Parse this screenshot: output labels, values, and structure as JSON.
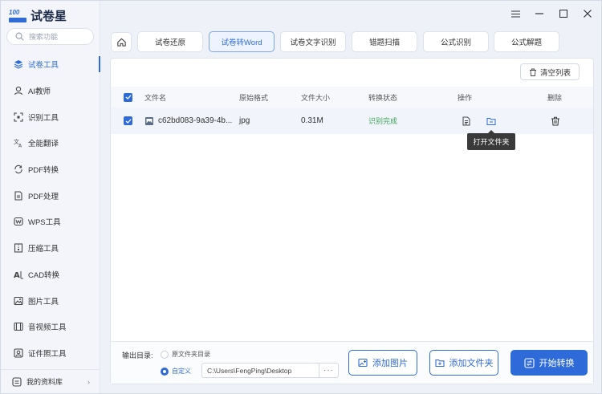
{
  "app": {
    "logo_badge": "100",
    "title": "试卷星"
  },
  "search": {
    "placeholder": "搜索功能"
  },
  "sidebar": {
    "items": [
      {
        "label": "试卷工具",
        "icon": "layers-icon",
        "active": true
      },
      {
        "label": "AI教师",
        "icon": "ai-teacher-icon"
      },
      {
        "label": "识别工具",
        "icon": "scan-icon"
      },
      {
        "label": "全能翻译",
        "icon": "translate-icon"
      },
      {
        "label": "PDF转换",
        "icon": "convert-icon"
      },
      {
        "label": "PDF处理",
        "icon": "pdf-icon"
      },
      {
        "label": "WPS工具",
        "icon": "wps-icon"
      },
      {
        "label": "压缩工具",
        "icon": "compress-icon"
      },
      {
        "label": "CAD转换",
        "icon": "cad-icon"
      },
      {
        "label": "图片工具",
        "icon": "image-icon"
      },
      {
        "label": "音视频工具",
        "icon": "media-icon"
      },
      {
        "label": "证件照工具",
        "icon": "id-photo-icon"
      }
    ],
    "library": "我的资料库"
  },
  "tabs": [
    "试卷还原",
    "试卷转Word",
    "试卷文字识别",
    "错题扫描",
    "公式识别",
    "公式解题"
  ],
  "active_tab": 1,
  "toolbar": {
    "clear_label": "清空列表"
  },
  "table": {
    "headers": {
      "name": "文件名",
      "format": "原始格式",
      "size": "文件大小",
      "status": "转换状态",
      "ops": "操作",
      "delete": "删除"
    },
    "rows": [
      {
        "name": "c62bd083-9a39-4b...",
        "format": "jpg",
        "size": "0.31M",
        "status": "识别完成"
      }
    ]
  },
  "tooltip": "打开文件夹",
  "footer": {
    "output_label": "输出目录:",
    "opt_source": "原文件夹目录",
    "opt_custom": "自定义",
    "path": "C:\\Users\\FengPing\\Desktop",
    "more": "···",
    "add_image": "添加图片",
    "add_folder": "添加文件夹",
    "start": "开始转换"
  },
  "colors": {
    "accent": "#2f6bd8",
    "success": "#3ea55a"
  }
}
